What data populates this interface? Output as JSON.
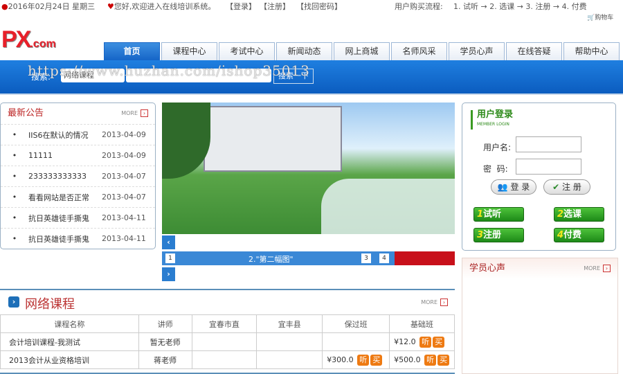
{
  "topbar": {
    "date": "2016年02月24日 星期三",
    "welcome": "您好,欢迎进入在线培训系统。",
    "login": "【登录】",
    "register": "【注册】",
    "recover": "【找回密码】",
    "flow_label": "用户购买流程:",
    "flow": "1. 试听 → 2. 选课 → 3. 注册 → 4. 付费",
    "cart": "购物车"
  },
  "logo": {
    "main": "PX",
    "suffix": ".com"
  },
  "nav": [
    "首页",
    "课程中心",
    "考试中心",
    "新闻动态",
    "网上商城",
    "名师风采",
    "学员心声",
    "在线答疑",
    "帮助中心"
  ],
  "search": {
    "label": "搜索:",
    "category": "网络课程",
    "button": "搜索一下"
  },
  "watermark": "https://www.huzhan.com/ishop35013",
  "notice": {
    "title": "最新公告",
    "more": "MORE",
    "items": [
      {
        "title": "IIS6在默认的情况",
        "date": "2013-04-09"
      },
      {
        "title": "11111",
        "date": "2013-04-09"
      },
      {
        "title": "233333333333",
        "date": "2013-04-07"
      },
      {
        "title": "看看网站是否正常",
        "date": "2013-04-07"
      },
      {
        "title": "抗日英雄徒手撕鬼",
        "date": "2013-04-11"
      },
      {
        "title": "抗日英雄徒手撕鬼",
        "date": "2013-04-11"
      }
    ]
  },
  "slider": {
    "caption": "2.\"第二幅图\"",
    "pages": [
      "1",
      "3",
      "4"
    ],
    "prev": "‹",
    "next": "›"
  },
  "login": {
    "title": "用户登录",
    "subtitle": "MEMBER LOGIN",
    "username_label": "用户名:",
    "password_label": "密  码:",
    "login_btn": "登 录",
    "register_btn": "注 册",
    "steps": [
      {
        "n": "1",
        "t": "试听"
      },
      {
        "n": "2",
        "t": "选课"
      },
      {
        "n": "3",
        "t": "注册"
      },
      {
        "n": "4",
        "t": "付费"
      }
    ]
  },
  "testimonials": {
    "title": "学员心声",
    "more": "MORE"
  },
  "courses": {
    "title": "网络课程",
    "more": "MORE",
    "headers": [
      "课程名称",
      "讲师",
      "宜春市直",
      "宜丰县",
      "保过班",
      "基础班"
    ],
    "rows": [
      {
        "name": "会计培训课程-我测试",
        "teacher": "暂无老师",
        "c1": "",
        "c2": "",
        "pass": "",
        "basic": "¥12.0"
      },
      {
        "name": "2013会计从业资格培训",
        "teacher": "蒋老师",
        "c1": "",
        "c2": "",
        "pass": "¥300.0",
        "basic": "¥500.0"
      }
    ],
    "listen": "听",
    "buy": "买"
  }
}
